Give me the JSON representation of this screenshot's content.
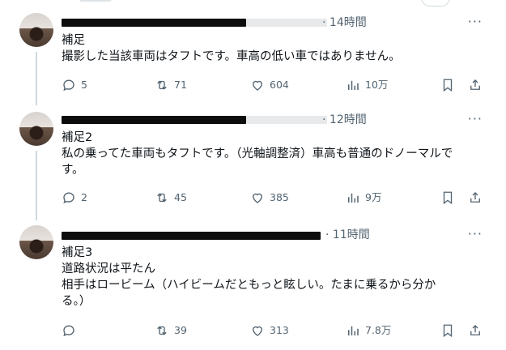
{
  "tweets": [
    {
      "time": "14時間",
      "dot": "·",
      "lines": [
        "補足",
        "撮影した当該車両はタフトです。車高の低い車ではありません。"
      ],
      "reply": "5",
      "retweet": "71",
      "like": "604",
      "views": "10万"
    },
    {
      "time": "12時間",
      "dot": "·",
      "lines": [
        "補足2",
        "私の乗ってた車両もタフトです。（光軸調整済）車高も普通のドノーマルで",
        "す。"
      ],
      "reply": "2",
      "retweet": "45",
      "like": "385",
      "views": "9万"
    },
    {
      "time": "11時間",
      "dot": "·",
      "lines": [
        "補足3",
        "道路状況は平たん",
        "相手はロービーム（ハイビームだともっと眩しい。たまに乗るから分か",
        "る。）"
      ],
      "reply": "",
      "retweet": "39",
      "like": "313",
      "views": "7.8万"
    }
  ],
  "more_label": "···"
}
